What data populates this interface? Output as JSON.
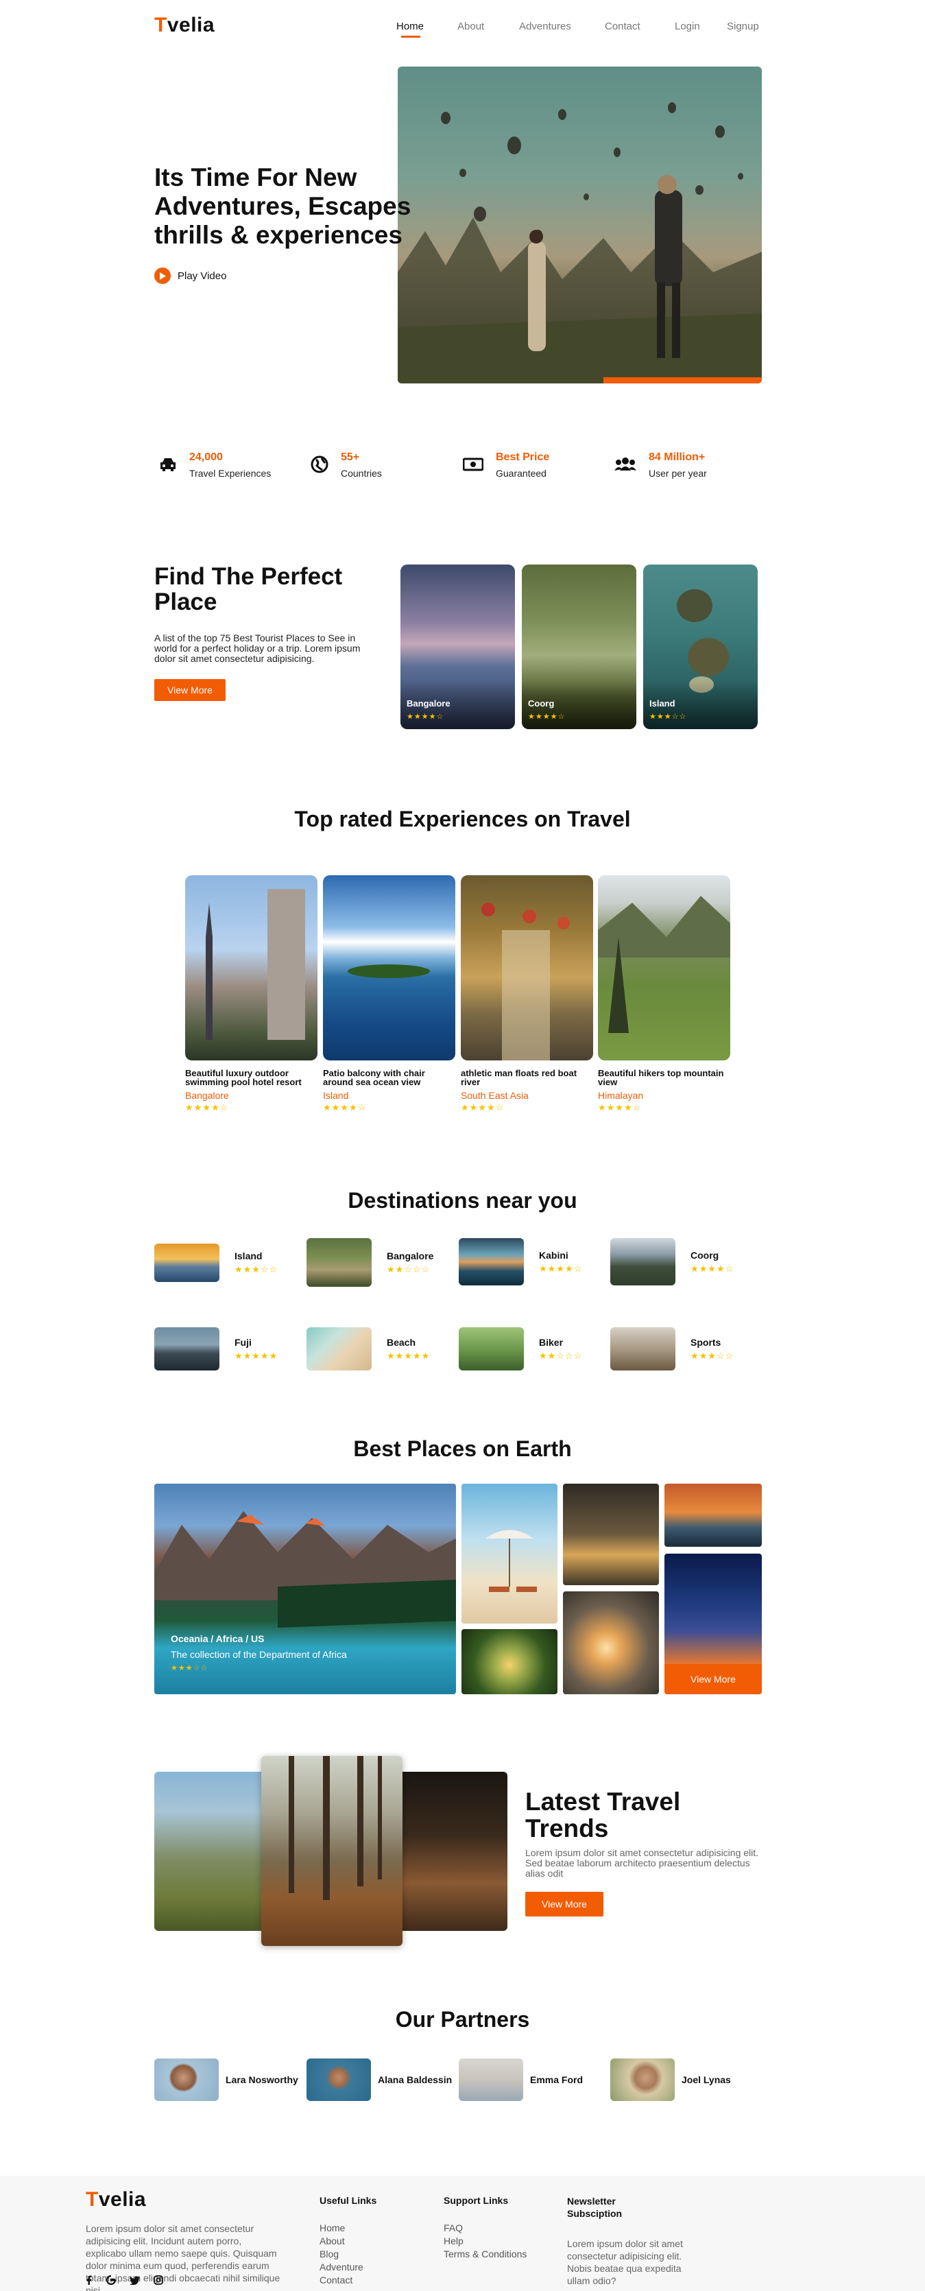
{
  "brand": {
    "logo_first": "T",
    "logo_rest": "velia"
  },
  "nav": {
    "items": [
      "Home",
      "About",
      "Adventures",
      "Contact",
      "Login",
      "Signup"
    ],
    "active": "Home"
  },
  "hero": {
    "title": "Its Time For New Adventures, Escapes thrills & experiences",
    "play_label": "Play Video"
  },
  "stats": [
    {
      "icon": "car-icon",
      "value": "24,000",
      "label": "Travel Experiences"
    },
    {
      "icon": "globe-icon",
      "value": "55+",
      "label": "Countries"
    },
    {
      "icon": "money-icon",
      "value": "Best Price",
      "label": "Guaranteed"
    },
    {
      "icon": "users-icon",
      "value": "84 Million+",
      "label": "User per year"
    }
  ],
  "find": {
    "title": "Find The Perfect Place",
    "desc": "A list of the top 75 Best Tourist Places to See in world for a perfect holiday or a trip. Lorem ipsum dolor sit amet consectetur adipisicing.",
    "button": "View More",
    "places": [
      {
        "name": "Bangalore",
        "rating": 4
      },
      {
        "name": "Coorg",
        "rating": 4
      },
      {
        "name": "Island",
        "rating": 3
      }
    ]
  },
  "top_rated": {
    "title": "Top rated Experiences on Travel",
    "items": [
      {
        "title": "Beautiful luxury outdoor swimming pool hotel resort",
        "place": "Bangalore",
        "rating": 4
      },
      {
        "title": "Patio balcony with chair around sea ocean view",
        "place": "Island",
        "rating": 4
      },
      {
        "title": "athletic man floats red boat river",
        "place": "South East Asia",
        "rating": 4
      },
      {
        "title": "Beautiful hikers top mountain view",
        "place": "Himalayan",
        "rating": 4
      }
    ]
  },
  "near": {
    "title": "Destinations near you",
    "items": [
      {
        "name": "Island",
        "rating": 3
      },
      {
        "name": "Bangalore",
        "rating": 2
      },
      {
        "name": "Kabini",
        "rating": 4
      },
      {
        "name": "Coorg",
        "rating": 4
      },
      {
        "name": "Fuji",
        "rating": 5
      },
      {
        "name": "Beach",
        "rating": 5
      },
      {
        "name": "Biker",
        "rating": 2
      },
      {
        "name": "Sports",
        "rating": 3
      }
    ]
  },
  "best": {
    "title": "Best Places on Earth",
    "caption_path": "Oceania / Africa / US",
    "caption_text": "The collection of the Department of Africa",
    "caption_rating": 3,
    "button": "View More"
  },
  "trends": {
    "title": "Latest Travel Trends",
    "desc": "Lorem ipsum dolor sit amet consectetur adipisicing elit. Sed beatae laborum architecto praesentium delectus alias odit",
    "button": "View More"
  },
  "partners": {
    "title": "Our Partners",
    "items": [
      "Lara Nosworthy",
      "Alana Baldessin",
      "Emma Ford",
      "Joel Lynas"
    ]
  },
  "footer": {
    "about": "Lorem ipsum dolor sit amet consectetur adipisicing elit. Incidunt autem porro, explicabo ullam nemo saepe quis. Quisquam dolor minima eum quod, perferendis earum totam, ipsam eligendi obcaecati nihil similique nisi",
    "useful_title": "Useful Links",
    "useful": [
      "Home",
      "About",
      "Blog",
      "Adventure",
      "Contact"
    ],
    "support_title": "Support Links",
    "support": [
      "FAQ",
      "Help",
      "Terms & Conditions"
    ],
    "newsletter_title": "Newsletter Subsciption",
    "newsletter_text": "Lorem ipsum dolor sit amet consectetur adipisicing elit. Nobis beatae qua expedita ullam odio?",
    "social": [
      "facebook-icon",
      "google-icon",
      "twitter-icon",
      "instagram-icon"
    ]
  },
  "colors": {
    "accent": "#f25c05",
    "star": "#f6c200"
  }
}
